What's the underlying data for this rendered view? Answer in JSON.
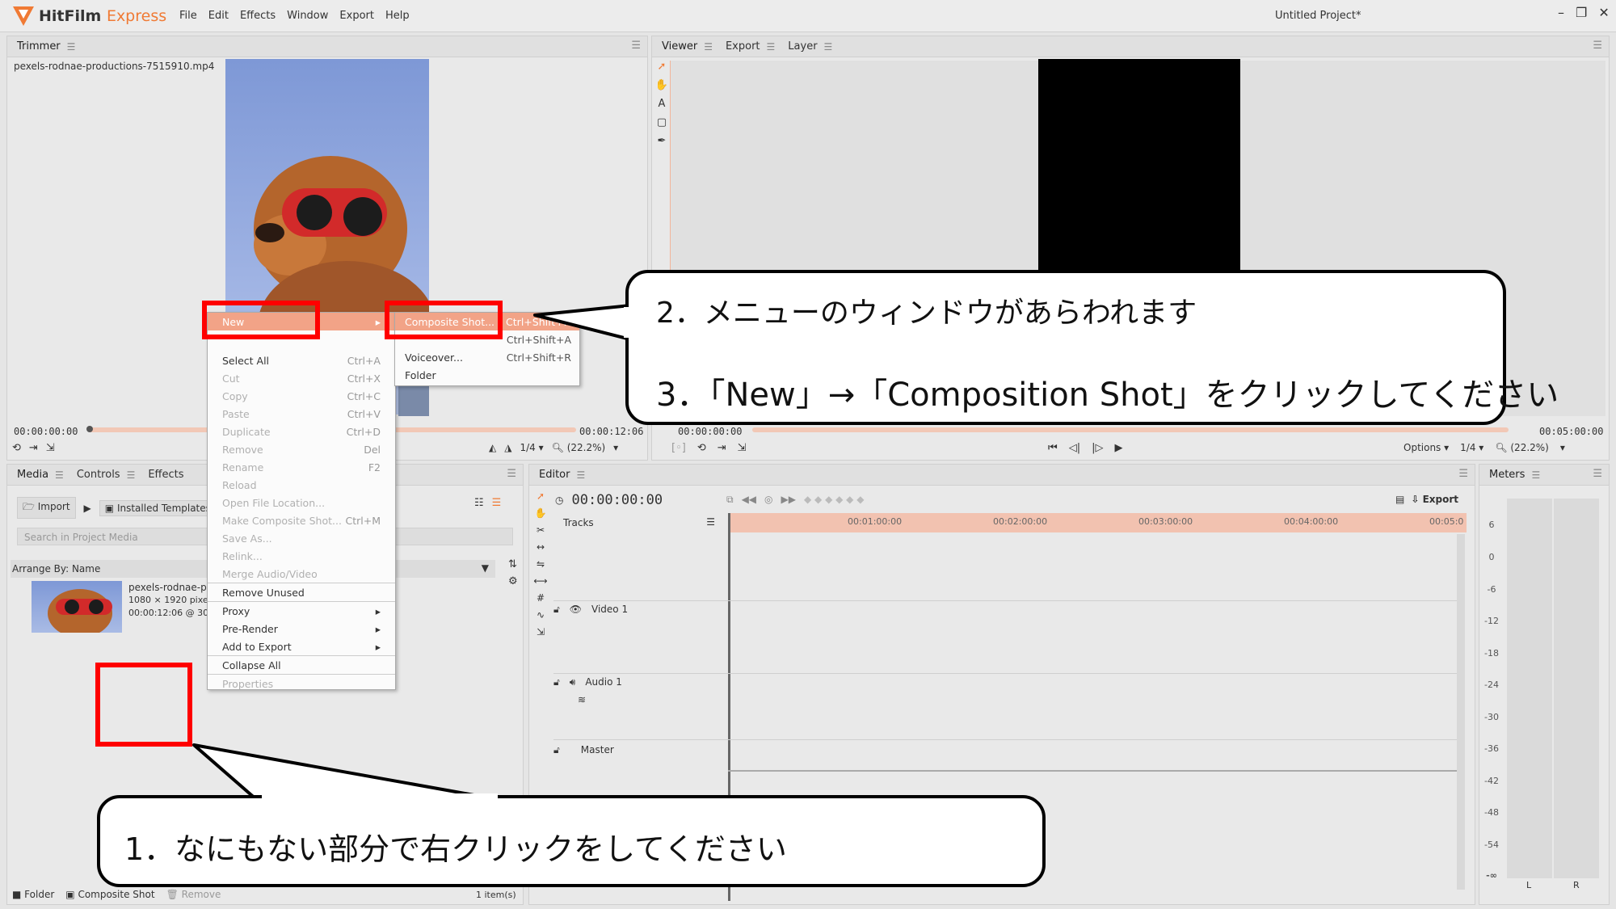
{
  "app": {
    "name_main": "HitFilm",
    "name_accent": "Express",
    "project_title": "Untitled Project*",
    "menus": [
      "File",
      "Edit",
      "Effects",
      "Window",
      "Export",
      "Help"
    ],
    "window_buttons": [
      "–",
      "❐",
      "✕"
    ]
  },
  "trimmer": {
    "tab": "Trimmer",
    "filename": "pexels-rodnae-productions-7515910.mp4",
    "timecode_start": "00:00:00:00",
    "timecode_end": "00:00:12:06",
    "resolution": "1/4",
    "zoom": "(22.2%)"
  },
  "viewer": {
    "tabs": [
      "Viewer",
      "Export",
      "Layer"
    ],
    "timecode_start": "00:00:00:00",
    "timecode_end": "00:05:00:00",
    "options_label": "Options",
    "resolution": "1/4",
    "zoom": "(22.2%)"
  },
  "media": {
    "tabs": [
      "Media",
      "Controls",
      "Effects"
    ],
    "import_label": "Import",
    "installed_templates_label": "Installed Templates",
    "search_placeholder": "Search in Project Media",
    "arrange_label": "Arrange By: Name",
    "item": {
      "name": "pexels-rodnae-p",
      "dims": "1080 × 1920 pixel",
      "duration": "00:00:12:06 @ 30"
    },
    "footer_folder": "Folder",
    "footer_composite": "Composite Shot",
    "footer_remove": "Remove",
    "item_count": "1 item(s)"
  },
  "context_menu": {
    "items": [
      {
        "label": "New",
        "shortcut": "",
        "state": "highlight",
        "submenu": true
      },
      {
        "label": "",
        "shortcut": "",
        "state": "blank",
        "submenu": false
      },
      {
        "label": "Select All",
        "shortcut": "Ctrl+A",
        "state": "enabled",
        "submenu": false
      },
      {
        "label": "Cut",
        "shortcut": "Ctrl+X",
        "state": "disabled",
        "submenu": false
      },
      {
        "label": "Copy",
        "shortcut": "Ctrl+C",
        "state": "disabled",
        "submenu": false
      },
      {
        "label": "Paste",
        "shortcut": "Ctrl+V",
        "state": "disabled",
        "submenu": false
      },
      {
        "label": "Duplicate",
        "shortcut": "Ctrl+D",
        "state": "disabled",
        "submenu": false
      },
      {
        "label": "Remove",
        "shortcut": "Del",
        "state": "disabled",
        "submenu": false
      },
      {
        "label": "Rename",
        "shortcut": "F2",
        "state": "disabled",
        "submenu": false
      },
      {
        "label": "Reload",
        "shortcut": "",
        "state": "disabled",
        "submenu": false
      },
      {
        "label": "Open File Location...",
        "shortcut": "",
        "state": "disabled",
        "submenu": false
      },
      {
        "label": "Make Composite Shot...",
        "shortcut": "Ctrl+M",
        "state": "disabled",
        "submenu": false
      },
      {
        "label": "Save As...",
        "shortcut": "",
        "state": "disabled",
        "submenu": false
      },
      {
        "label": "Relink...",
        "shortcut": "",
        "state": "disabled",
        "submenu": false
      },
      {
        "label": "Merge Audio/Video",
        "shortcut": "",
        "state": "disabled",
        "submenu": false
      },
      {
        "label": "Remove Unused",
        "shortcut": "",
        "state": "enabled",
        "submenu": false
      },
      {
        "label": "Proxy",
        "shortcut": "",
        "state": "enabled",
        "submenu": true
      },
      {
        "label": "Pre-Render",
        "shortcut": "",
        "state": "enabled",
        "submenu": true
      },
      {
        "label": "Add to Export",
        "shortcut": "",
        "state": "enabled",
        "submenu": true
      },
      {
        "label": "Collapse All",
        "shortcut": "",
        "state": "enabled",
        "submenu": false
      },
      {
        "label": "Properties",
        "shortcut": "",
        "state": "disabled",
        "submenu": false
      }
    ],
    "submenu": [
      {
        "label": "Composite Shot...",
        "shortcut": "Ctrl+Shift+N",
        "state": "highlight"
      },
      {
        "label": "",
        "shortcut": "Ctrl+Shift+A",
        "state": "enabled"
      },
      {
        "label": "Voiceover...",
        "shortcut": "Ctrl+Shift+R",
        "state": "enabled"
      },
      {
        "label": "Folder",
        "shortcut": "",
        "state": "enabled"
      }
    ]
  },
  "editor": {
    "tab": "Editor",
    "timecode": "00:00:00:00",
    "export_label": "Export",
    "tracks_label": "Tracks",
    "ruler": [
      "00:01:00:00",
      "00:02:00:00",
      "00:03:00:00",
      "00:04:00:00",
      "00:05:0"
    ],
    "tracks": [
      "Video 1",
      "Audio 1",
      "Master"
    ]
  },
  "meters": {
    "tab": "Meters",
    "scale": [
      "6",
      "0",
      "-6",
      "-12",
      "-18",
      "-24",
      "-30",
      "-36",
      "-42",
      "-48",
      "-54",
      "-∞"
    ],
    "channels": [
      "L",
      "R"
    ]
  },
  "annotations": {
    "step1": "1．なにもない部分で右クリックをしてください",
    "step2": "2．メニューのウィンドウがあらわれます",
    "step3": "3．「New」→「Composition Shot」をクリックしてください"
  },
  "colors": {
    "accent": "#f07a34",
    "highlight": "#f2a387",
    "red_box": "#ff0000",
    "ruler": "#f2c2b0"
  }
}
